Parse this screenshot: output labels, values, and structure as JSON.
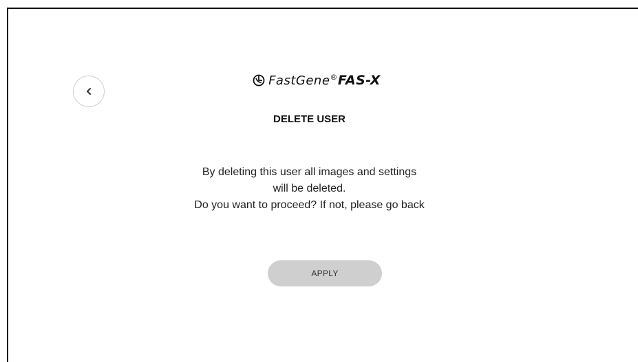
{
  "logo": {
    "brand": "FastGene",
    "registered_mark": "®",
    "model": "FAS-X"
  },
  "page": {
    "title": "DELETE USER",
    "message_lines": [
      "By deleting this user all images and settings",
      "will be deleted.",
      "Do you want to proceed? If not, please go back"
    ]
  },
  "actions": {
    "back_icon": "chevron-left-icon",
    "apply_label": "APPLY"
  },
  "colors": {
    "button_bg": "#cfcfcf",
    "text": "#222222",
    "frame": "#111111"
  }
}
